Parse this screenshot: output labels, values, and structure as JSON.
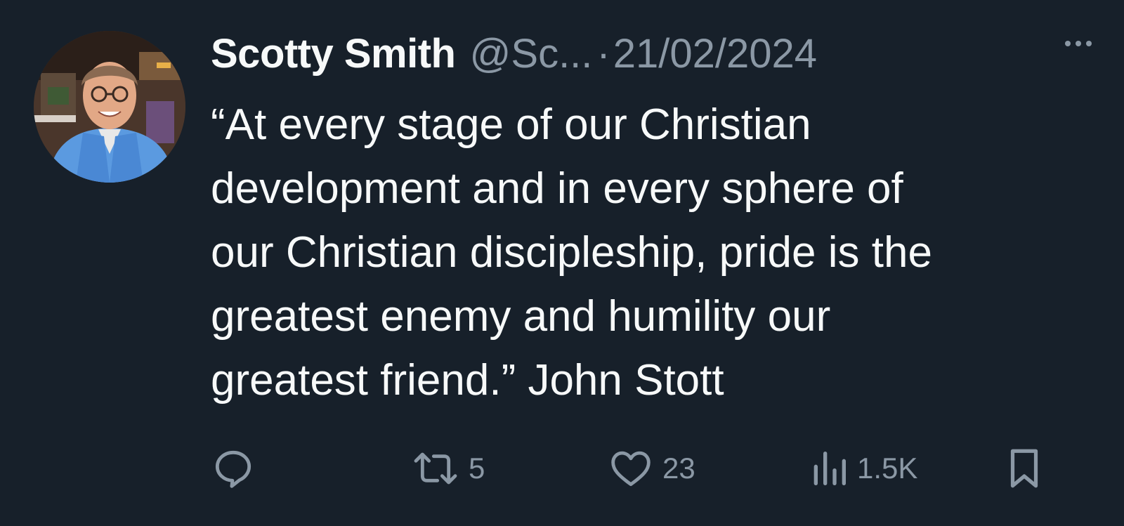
{
  "tweet": {
    "author_name": "Scotty Smith",
    "author_handle": "@Sc...",
    "separator": "·",
    "date": "21/02/2024",
    "text_lines": [
      "“At every stage of our Christian",
      "development and in every sphere of",
      "our Christian discipleship, pride is the",
      "greatest enemy and humility our",
      "greatest friend.” John Stott"
    ]
  },
  "actions": {
    "reply": {
      "icon": "reply-icon",
      "count": ""
    },
    "retweet": {
      "icon": "retweet-icon",
      "count": "5"
    },
    "like": {
      "icon": "heart-icon",
      "count": "23"
    },
    "views": {
      "icon": "views-icon",
      "count": "1.5K"
    },
    "bookmark": {
      "icon": "bookmark-icon",
      "count": ""
    }
  },
  "colors": {
    "background": "#17202a",
    "primary_text": "#f7f9f9",
    "secondary_text": "#8b98a5"
  }
}
